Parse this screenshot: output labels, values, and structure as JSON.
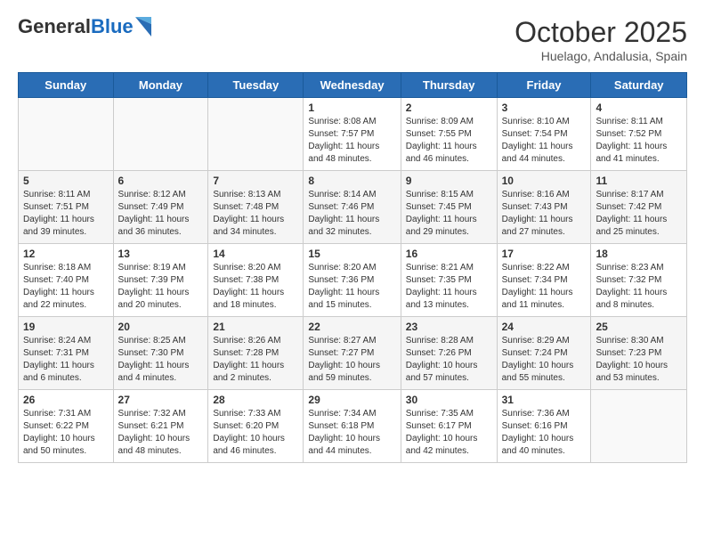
{
  "logo": {
    "general": "General",
    "blue": "Blue"
  },
  "title": "October 2025",
  "location": "Huelago, Andalusia, Spain",
  "days_of_week": [
    "Sunday",
    "Monday",
    "Tuesday",
    "Wednesday",
    "Thursday",
    "Friday",
    "Saturday"
  ],
  "weeks": [
    [
      {
        "day": "",
        "info": ""
      },
      {
        "day": "",
        "info": ""
      },
      {
        "day": "",
        "info": ""
      },
      {
        "day": "1",
        "info": "Sunrise: 8:08 AM\nSunset: 7:57 PM\nDaylight: 11 hours and 48 minutes."
      },
      {
        "day": "2",
        "info": "Sunrise: 8:09 AM\nSunset: 7:55 PM\nDaylight: 11 hours and 46 minutes."
      },
      {
        "day": "3",
        "info": "Sunrise: 8:10 AM\nSunset: 7:54 PM\nDaylight: 11 hours and 44 minutes."
      },
      {
        "day": "4",
        "info": "Sunrise: 8:11 AM\nSunset: 7:52 PM\nDaylight: 11 hours and 41 minutes."
      }
    ],
    [
      {
        "day": "5",
        "info": "Sunrise: 8:11 AM\nSunset: 7:51 PM\nDaylight: 11 hours and 39 minutes."
      },
      {
        "day": "6",
        "info": "Sunrise: 8:12 AM\nSunset: 7:49 PM\nDaylight: 11 hours and 36 minutes."
      },
      {
        "day": "7",
        "info": "Sunrise: 8:13 AM\nSunset: 7:48 PM\nDaylight: 11 hours and 34 minutes."
      },
      {
        "day": "8",
        "info": "Sunrise: 8:14 AM\nSunset: 7:46 PM\nDaylight: 11 hours and 32 minutes."
      },
      {
        "day": "9",
        "info": "Sunrise: 8:15 AM\nSunset: 7:45 PM\nDaylight: 11 hours and 29 minutes."
      },
      {
        "day": "10",
        "info": "Sunrise: 8:16 AM\nSunset: 7:43 PM\nDaylight: 11 hours and 27 minutes."
      },
      {
        "day": "11",
        "info": "Sunrise: 8:17 AM\nSunset: 7:42 PM\nDaylight: 11 hours and 25 minutes."
      }
    ],
    [
      {
        "day": "12",
        "info": "Sunrise: 8:18 AM\nSunset: 7:40 PM\nDaylight: 11 hours and 22 minutes."
      },
      {
        "day": "13",
        "info": "Sunrise: 8:19 AM\nSunset: 7:39 PM\nDaylight: 11 hours and 20 minutes."
      },
      {
        "day": "14",
        "info": "Sunrise: 8:20 AM\nSunset: 7:38 PM\nDaylight: 11 hours and 18 minutes."
      },
      {
        "day": "15",
        "info": "Sunrise: 8:20 AM\nSunset: 7:36 PM\nDaylight: 11 hours and 15 minutes."
      },
      {
        "day": "16",
        "info": "Sunrise: 8:21 AM\nSunset: 7:35 PM\nDaylight: 11 hours and 13 minutes."
      },
      {
        "day": "17",
        "info": "Sunrise: 8:22 AM\nSunset: 7:34 PM\nDaylight: 11 hours and 11 minutes."
      },
      {
        "day": "18",
        "info": "Sunrise: 8:23 AM\nSunset: 7:32 PM\nDaylight: 11 hours and 8 minutes."
      }
    ],
    [
      {
        "day": "19",
        "info": "Sunrise: 8:24 AM\nSunset: 7:31 PM\nDaylight: 11 hours and 6 minutes."
      },
      {
        "day": "20",
        "info": "Sunrise: 8:25 AM\nSunset: 7:30 PM\nDaylight: 11 hours and 4 minutes."
      },
      {
        "day": "21",
        "info": "Sunrise: 8:26 AM\nSunset: 7:28 PM\nDaylight: 11 hours and 2 minutes."
      },
      {
        "day": "22",
        "info": "Sunrise: 8:27 AM\nSunset: 7:27 PM\nDaylight: 10 hours and 59 minutes."
      },
      {
        "day": "23",
        "info": "Sunrise: 8:28 AM\nSunset: 7:26 PM\nDaylight: 10 hours and 57 minutes."
      },
      {
        "day": "24",
        "info": "Sunrise: 8:29 AM\nSunset: 7:24 PM\nDaylight: 10 hours and 55 minutes."
      },
      {
        "day": "25",
        "info": "Sunrise: 8:30 AM\nSunset: 7:23 PM\nDaylight: 10 hours and 53 minutes."
      }
    ],
    [
      {
        "day": "26",
        "info": "Sunrise: 7:31 AM\nSunset: 6:22 PM\nDaylight: 10 hours and 50 minutes."
      },
      {
        "day": "27",
        "info": "Sunrise: 7:32 AM\nSunset: 6:21 PM\nDaylight: 10 hours and 48 minutes."
      },
      {
        "day": "28",
        "info": "Sunrise: 7:33 AM\nSunset: 6:20 PM\nDaylight: 10 hours and 46 minutes."
      },
      {
        "day": "29",
        "info": "Sunrise: 7:34 AM\nSunset: 6:18 PM\nDaylight: 10 hours and 44 minutes."
      },
      {
        "day": "30",
        "info": "Sunrise: 7:35 AM\nSunset: 6:17 PM\nDaylight: 10 hours and 42 minutes."
      },
      {
        "day": "31",
        "info": "Sunrise: 7:36 AM\nSunset: 6:16 PM\nDaylight: 10 hours and 40 minutes."
      },
      {
        "day": "",
        "info": ""
      }
    ]
  ]
}
